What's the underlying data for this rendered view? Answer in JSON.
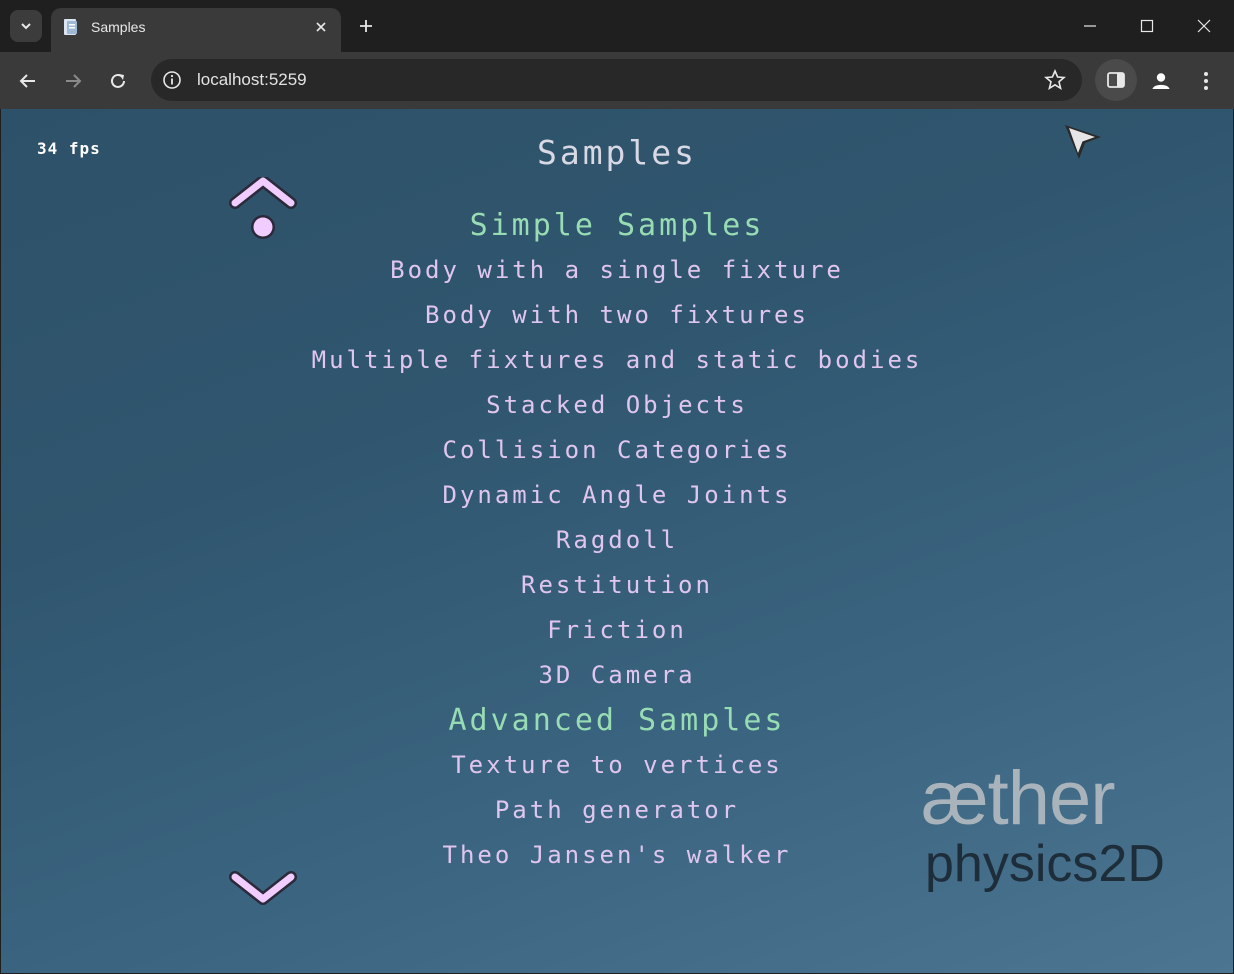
{
  "browser": {
    "tab": {
      "title": "Samples"
    },
    "address": {
      "url": "localhost:5259"
    }
  },
  "game": {
    "fps": "34 fps",
    "title": "Samples",
    "menu": [
      {
        "label": "Simple Samples",
        "type": "category"
      },
      {
        "label": "Body with a single fixture",
        "type": "item"
      },
      {
        "label": "Body with two fixtures",
        "type": "item"
      },
      {
        "label": "Multiple fixtures and static bodies",
        "type": "item"
      },
      {
        "label": "Stacked Objects",
        "type": "item"
      },
      {
        "label": "Collision Categories",
        "type": "item"
      },
      {
        "label": "Dynamic Angle Joints",
        "type": "item"
      },
      {
        "label": "Ragdoll",
        "type": "item"
      },
      {
        "label": "Restitution",
        "type": "item"
      },
      {
        "label": "Friction",
        "type": "item"
      },
      {
        "label": "3D Camera",
        "type": "item"
      },
      {
        "label": "Advanced Samples",
        "type": "category"
      },
      {
        "label": "Texture to vertices",
        "type": "item"
      },
      {
        "label": "Path generator",
        "type": "item"
      },
      {
        "label": "Theo Jansen's walker",
        "type": "item"
      }
    ],
    "logo": {
      "line1": "æther",
      "line2": "physics2D"
    },
    "colors": {
      "category": "#98dcb4",
      "item": "#e0c6ee",
      "title": "#d9d9e6",
      "scroll_arrow": "#f0ccff"
    },
    "icons": [
      "scroll-up-arrow-icon",
      "scroll-down-arrow-icon",
      "pointer-cursor-icon"
    ]
  }
}
